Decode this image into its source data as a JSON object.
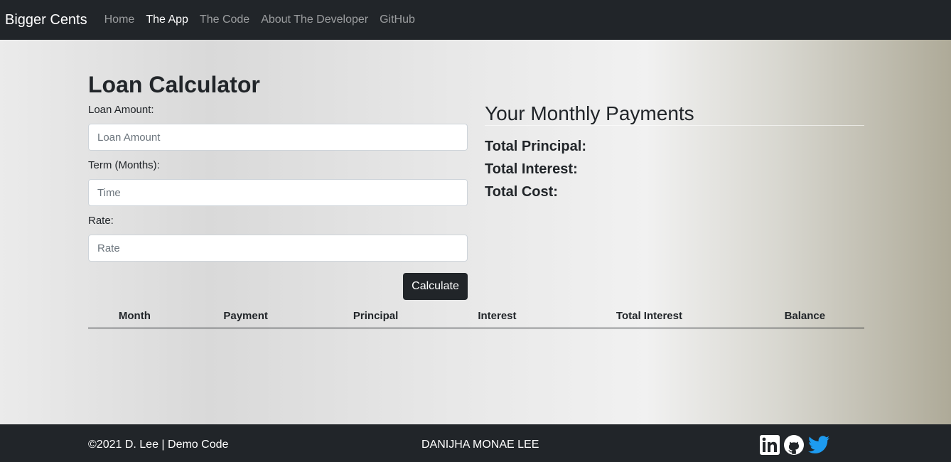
{
  "nav": {
    "brand": "Bigger Cents",
    "links": [
      "Home",
      "The App",
      "The Code",
      "About The Developer",
      "GitHub"
    ],
    "active_index": 1
  },
  "form": {
    "title": "Loan Calculator",
    "loan_amount": {
      "label": "Loan Amount:",
      "placeholder": "Loan Amount",
      "value": ""
    },
    "term": {
      "label": "Term (Months):",
      "placeholder": "Time",
      "value": ""
    },
    "rate": {
      "label": "Rate:",
      "placeholder": "Rate",
      "value": ""
    },
    "button": "Calculate"
  },
  "summary": {
    "title": "Your Monthly Payments",
    "total_principal": "Total Principal:",
    "total_interest": "Total Interest:",
    "total_cost": "Total Cost:"
  },
  "table": {
    "headers": [
      "Month",
      "Payment",
      "Principal",
      "Interest",
      "Total Interest",
      "Balance"
    ],
    "rows": []
  },
  "footer": {
    "copyright": "©2021 D. Lee | Demo Code",
    "name": "DANIJHA MONAE LEE",
    "social_icons": [
      "linkedin-icon",
      "github-icon",
      "twitter-icon"
    ]
  },
  "colors": {
    "nav_bg": "#212529",
    "button_bg": "#212529",
    "accent_right": "#aeaa98"
  }
}
